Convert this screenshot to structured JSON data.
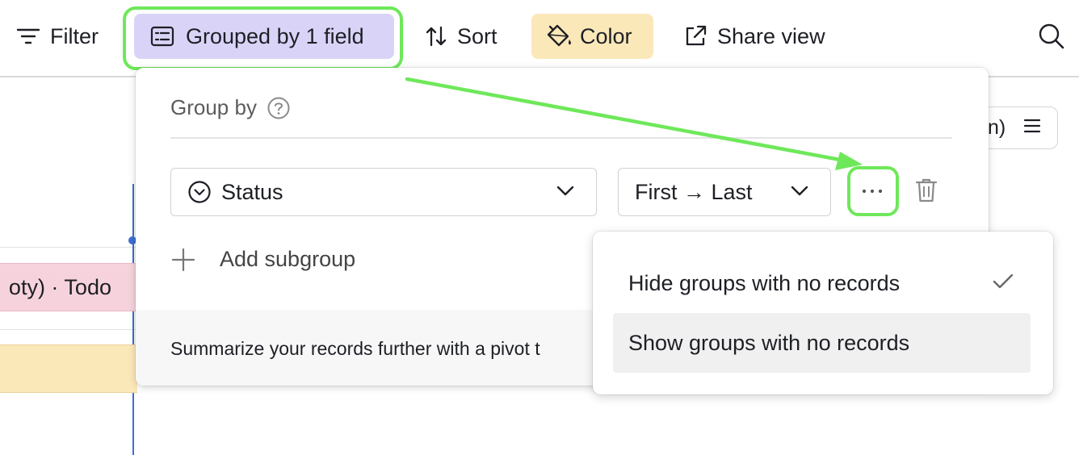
{
  "toolbar": {
    "filter_label": "Filter",
    "group_label": "Grouped by 1 field",
    "sort_label": "Sort",
    "color_label": "Color",
    "share_label": "Share view"
  },
  "background": {
    "todo_label": "oty) · Todo",
    "pill_text": "n)"
  },
  "group_popup": {
    "title": "Group by",
    "field_value": "Status",
    "order_value": "First → Last",
    "add_subgroup_label": "Add subgroup",
    "footer_text": "Summarize your records further with a pivot t"
  },
  "options_menu": {
    "items": [
      {
        "label": "Hide groups with no records",
        "checked": true
      },
      {
        "label": "Show groups with no records",
        "checked": false
      }
    ]
  },
  "colors": {
    "group_button_bg": "#d9d4f7",
    "color_button_bg": "#fbe8b9",
    "highlight": "#6ee85a",
    "todo_row_bg": "#f6d3dc"
  },
  "icons": {
    "filter": "filter-lines-icon",
    "group": "list-group-icon",
    "sort": "sort-arrows-icon",
    "color": "paint-bucket-icon",
    "share": "external-link-icon",
    "search": "search-icon",
    "help": "question-circle-icon",
    "status_field": "chevron-circle-icon",
    "more": "ellipsis-icon",
    "trash": "trash-icon",
    "add": "plus-icon",
    "check": "check-icon"
  }
}
